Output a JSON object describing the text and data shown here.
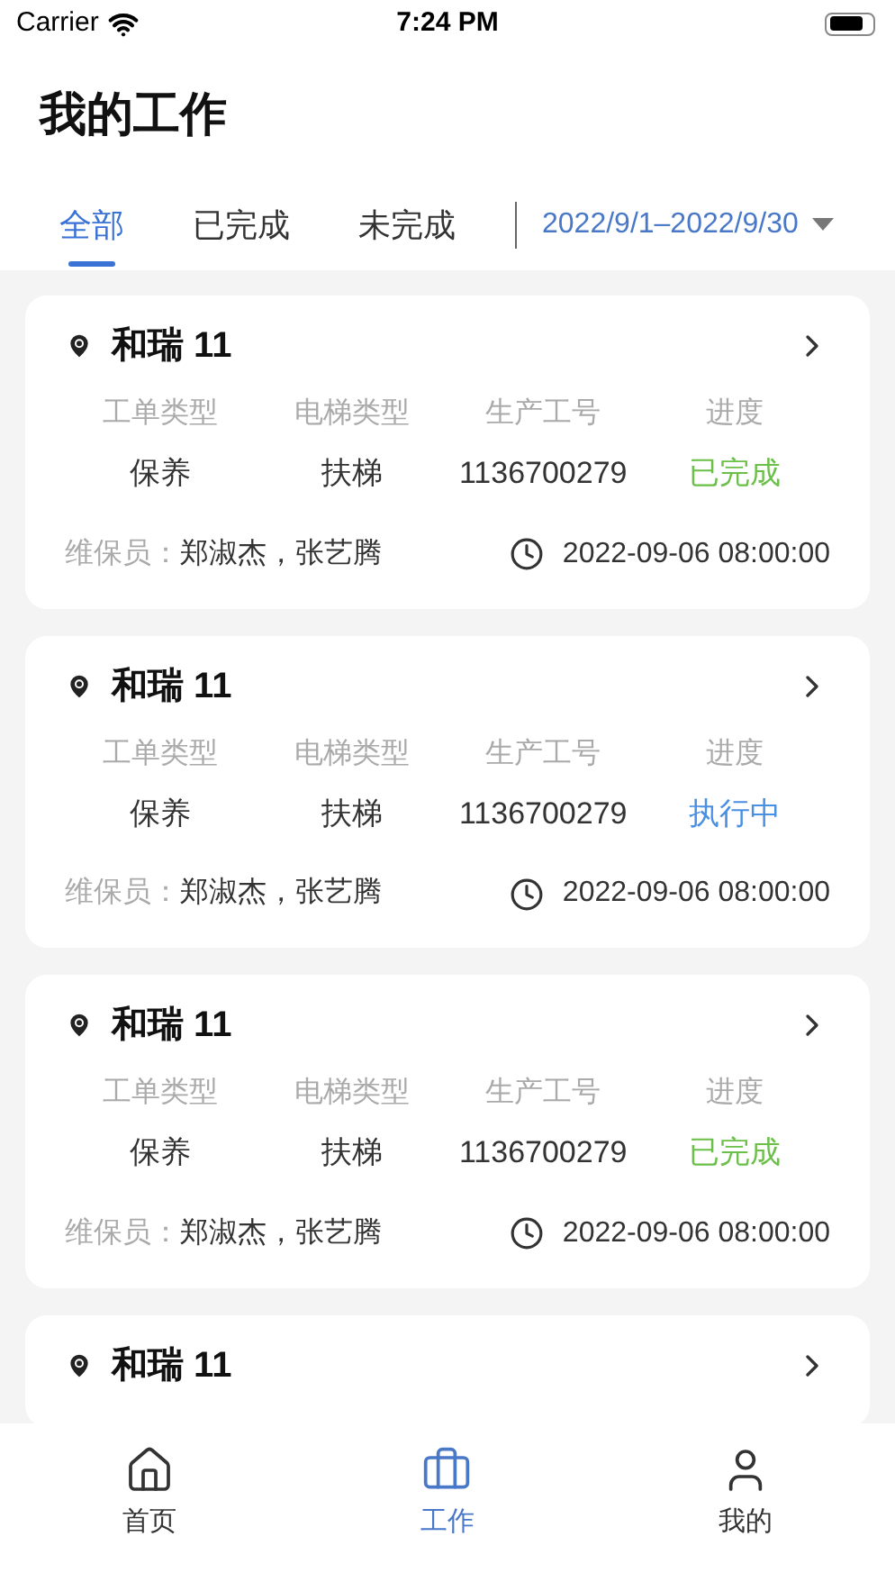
{
  "status_bar": {
    "carrier": "Carrier",
    "time": "7:24 PM"
  },
  "title": "我的工作",
  "tabs": [
    {
      "label": "全部",
      "selected": true
    },
    {
      "label": "已完成",
      "selected": false
    },
    {
      "label": "未完成",
      "selected": false
    }
  ],
  "date_range": "2022/9/1–2022/9/30",
  "cards": [
    {
      "name": "和瑞 11",
      "labels": [
        "工单类型",
        "电梯类型",
        "生产工号",
        "进度"
      ],
      "values": [
        "保养",
        "扶梯",
        "1136700279"
      ],
      "progress": {
        "text": "已完成",
        "kind": "done"
      },
      "staff_label": "维保员：",
      "staff": "郑淑杰，张艺腾",
      "time": "2022-09-06 08:00:00"
    },
    {
      "name": "和瑞 11",
      "labels": [
        "工单类型",
        "电梯类型",
        "生产工号",
        "进度"
      ],
      "values": [
        "保养",
        "扶梯",
        "1136700279"
      ],
      "progress": {
        "text": "执行中",
        "kind": "in_progress"
      },
      "staff_label": "维保员：",
      "staff": "郑淑杰，张艺腾",
      "time": "2022-09-06 08:00:00"
    },
    {
      "name": "和瑞 11",
      "labels": [
        "工单类型",
        "电梯类型",
        "生产工号",
        "进度"
      ],
      "values": [
        "保养",
        "扶梯",
        "1136700279"
      ],
      "progress": {
        "text": "已完成",
        "kind": "done"
      },
      "staff_label": "维保员：",
      "staff": "郑淑杰，张艺腾",
      "time": "2022-09-06 08:00:00"
    },
    {
      "name": "和瑞 11"
    }
  ],
  "tab_bar": [
    {
      "label": "首页",
      "kind": "home",
      "selected": false
    },
    {
      "label": "工作",
      "kind": "briefcase",
      "selected": true
    },
    {
      "label": "我的",
      "kind": "user",
      "selected": false
    }
  ]
}
